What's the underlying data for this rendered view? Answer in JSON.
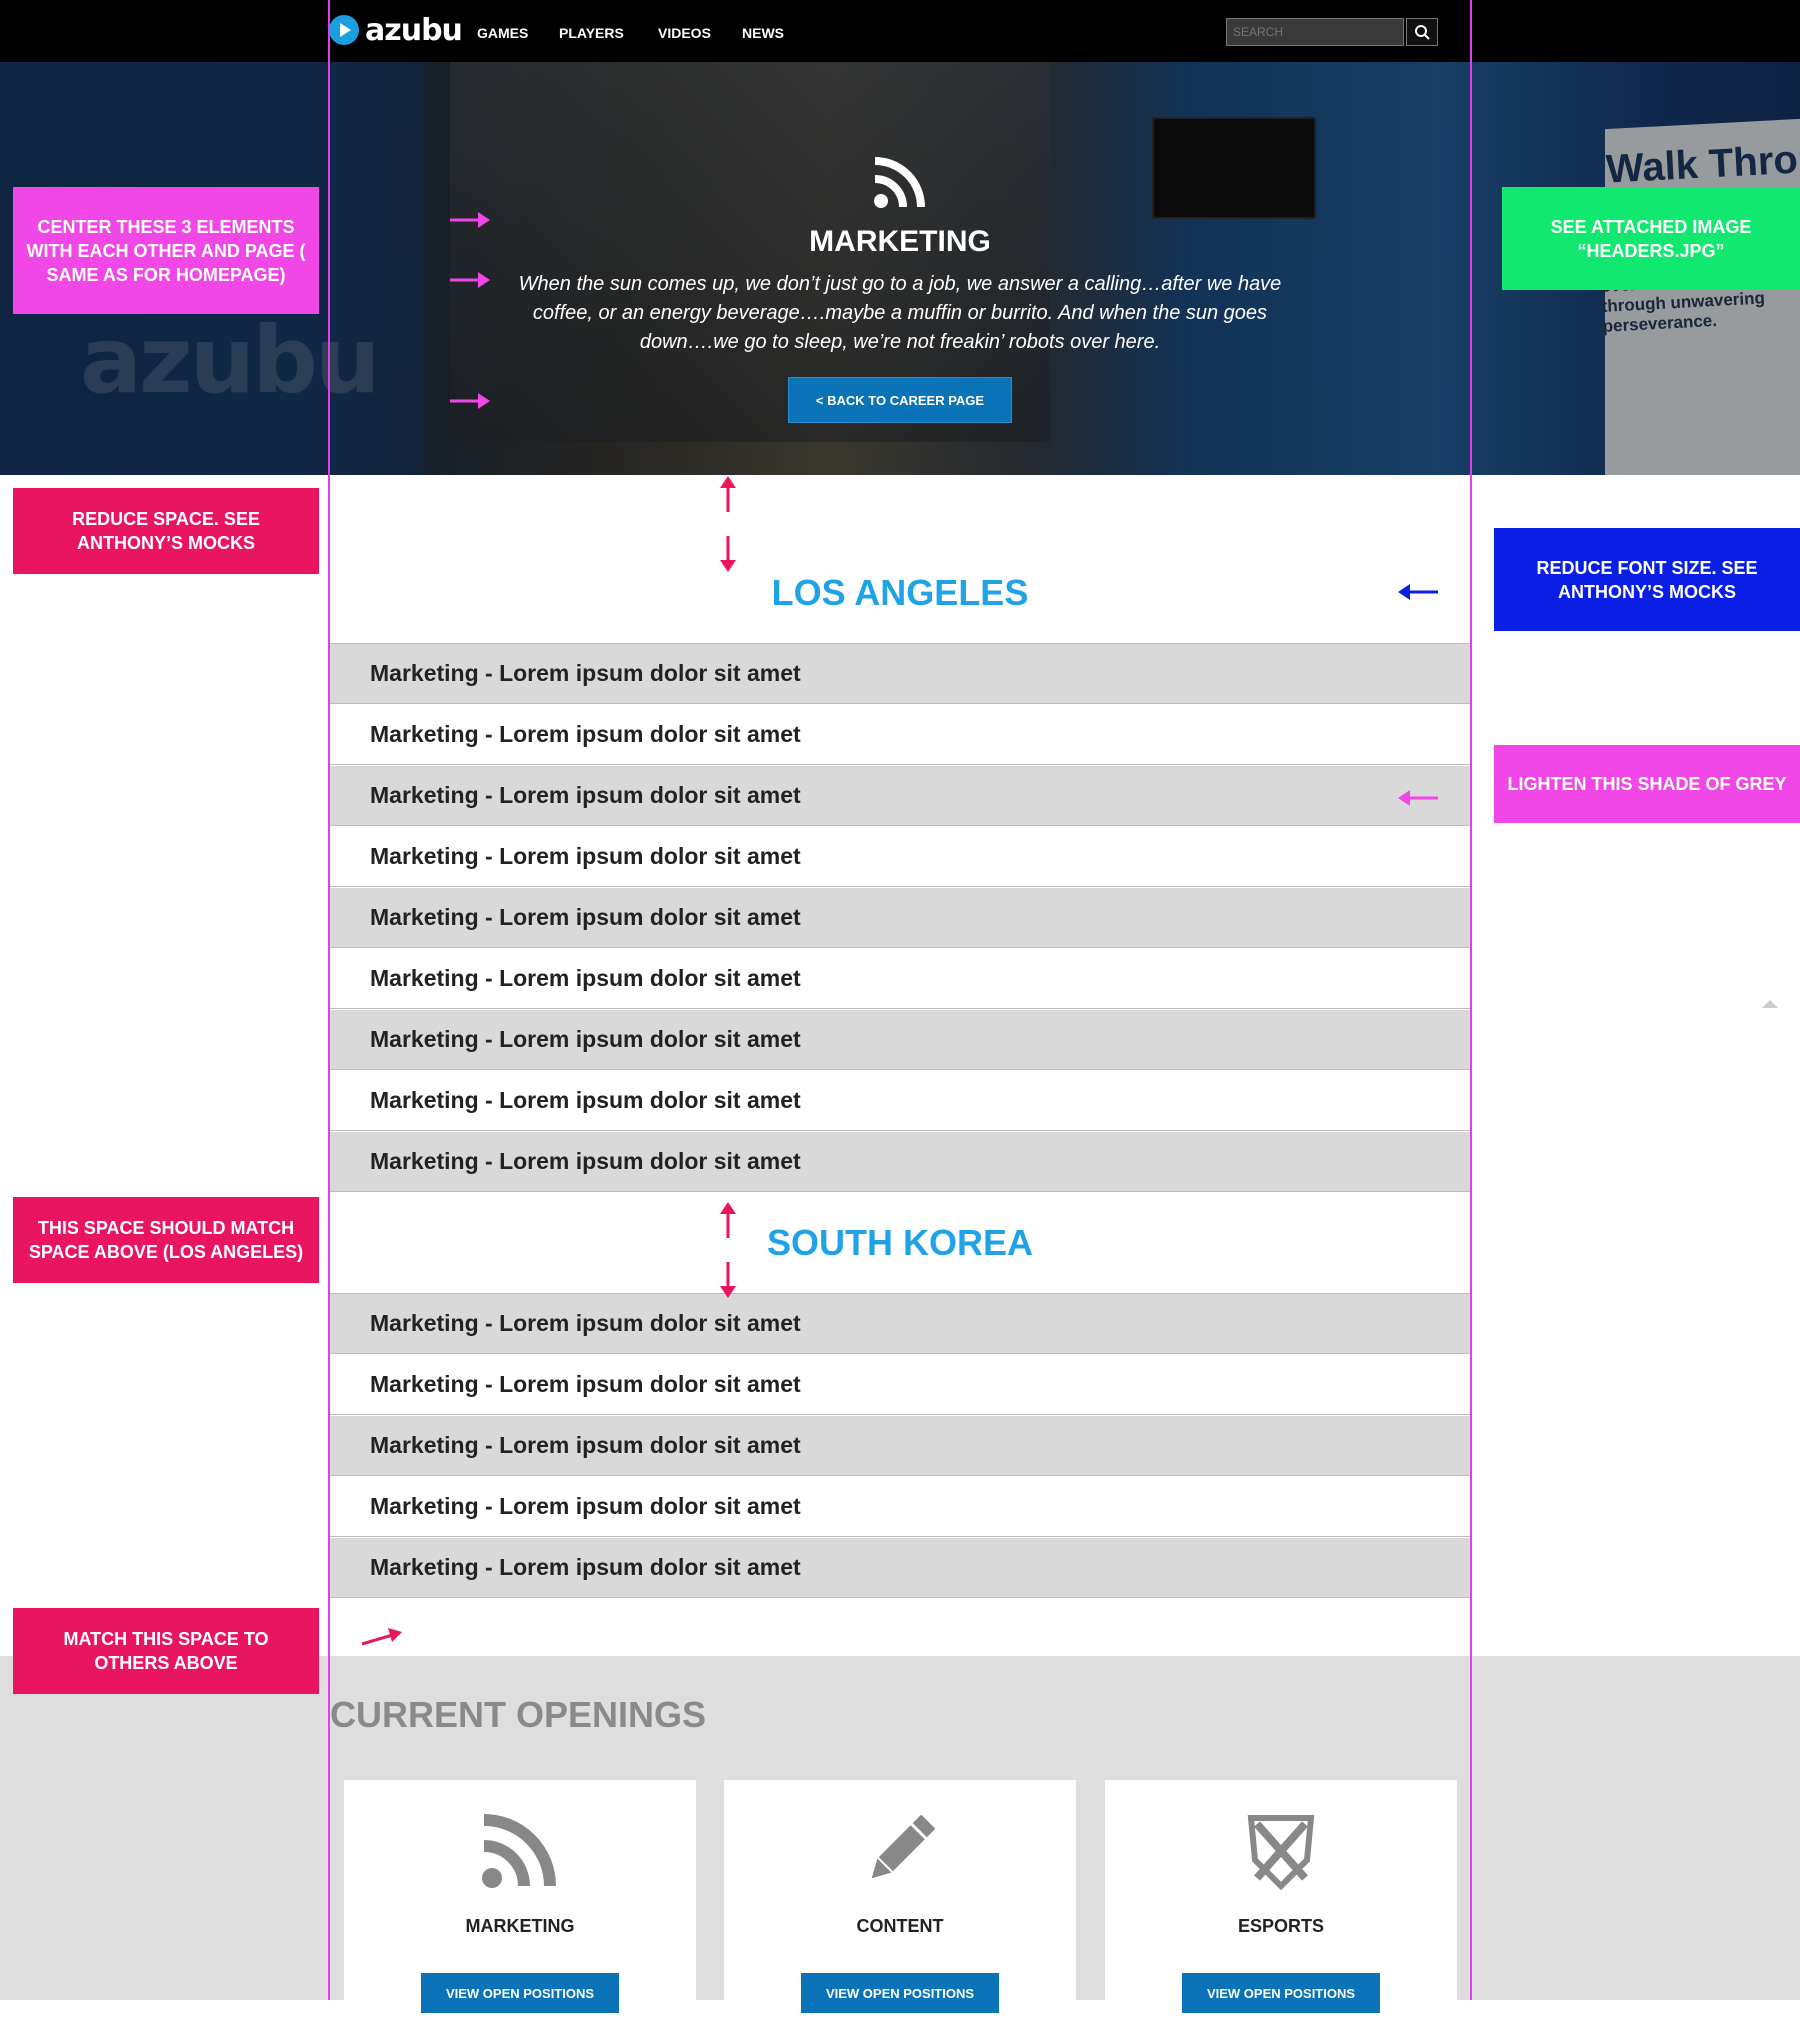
{
  "nav": {
    "logo_text": "azubu",
    "links": [
      "GAMES",
      "PLAYERS",
      "VIDEOS",
      "NEWS"
    ],
    "search_placeholder": "SEARCH"
  },
  "hero": {
    "title": "MARKETING",
    "text": "When the sun comes up, we don’t just go to a job, we answer a calling…after we have coffee, or an energy beverage….maybe a muffin or burrito. And when the sun goes down….we go to sleep, we’re not freakin’ robots over here.",
    "back_button": "< BACK TO CAREER PAGE",
    "background_logo": "azubu",
    "board_title": "Walk Throu",
    "board_text": "other through our shared challenges. We work toget to overcome our trials through unwavering perseverance."
  },
  "sections": [
    {
      "title": "LOS ANGELES",
      "rows": [
        "Marketing - Lorem ipsum dolor sit amet",
        "Marketing - Lorem ipsum dolor sit amet",
        "Marketing - Lorem ipsum dolor sit amet",
        "Marketing - Lorem ipsum dolor sit amet",
        "Marketing - Lorem ipsum dolor sit amet",
        "Marketing - Lorem ipsum dolor sit amet",
        "Marketing - Lorem ipsum dolor sit amet",
        "Marketing - Lorem ipsum dolor sit amet",
        "Marketing - Lorem ipsum dolor sit amet"
      ]
    },
    {
      "title": "SOUTH KOREA",
      "rows": [
        "Marketing - Lorem ipsum dolor sit amet",
        "Marketing - Lorem ipsum dolor sit amet",
        "Marketing - Lorem ipsum dolor sit amet",
        "Marketing - Lorem ipsum dolor sit amet",
        "Marketing - Lorem ipsum dolor sit amet"
      ]
    }
  ],
  "openings": {
    "title": "CURRENT OPENINGS",
    "cards": [
      {
        "label": "MARKETING",
        "button": "VIEW OPEN POSITIONS",
        "icon": "rss-icon"
      },
      {
        "label": "CONTENT",
        "button": "VIEW OPEN POSITIONS",
        "icon": "pencil-icon"
      },
      {
        "label": "ESPORTS",
        "button": "VIEW OPEN POSITIONS",
        "icon": "crossed-swords-shield-icon"
      }
    ]
  },
  "annotations": {
    "center_elements": "CENTER THESE 3 ELEMENTS WITH EACH OTHER AND PAGE ( SAME AS FOR HOMEPAGE)",
    "see_attached": "SEE ATTACHED IMAGE “HEADERS.JPG”",
    "reduce_space": "REDUCE SPACE. SEE ANTHONY’S MOCKS",
    "reduce_font": "REDUCE FONT SIZE. SEE ANTHONY’S MOCKS",
    "lighten_grey": "LIGHTEN THIS SHADE OF GREY",
    "match_space_above": "THIS SPACE SHOULD MATCH SPACE ABOVE (LOS ANGELES)",
    "match_space_others": "MATCH THIS SPACE TO OTHERS ABOVE"
  },
  "colors": {
    "accent_blue": "#1fa3e6",
    "button_blue": "#0b74b8",
    "annotation_magenta": "#f047e6",
    "annotation_red": "#e91561",
    "annotation_green": "#10e86f",
    "annotation_blue": "#0a1ee6",
    "row_grey": "#d9d9d9"
  }
}
